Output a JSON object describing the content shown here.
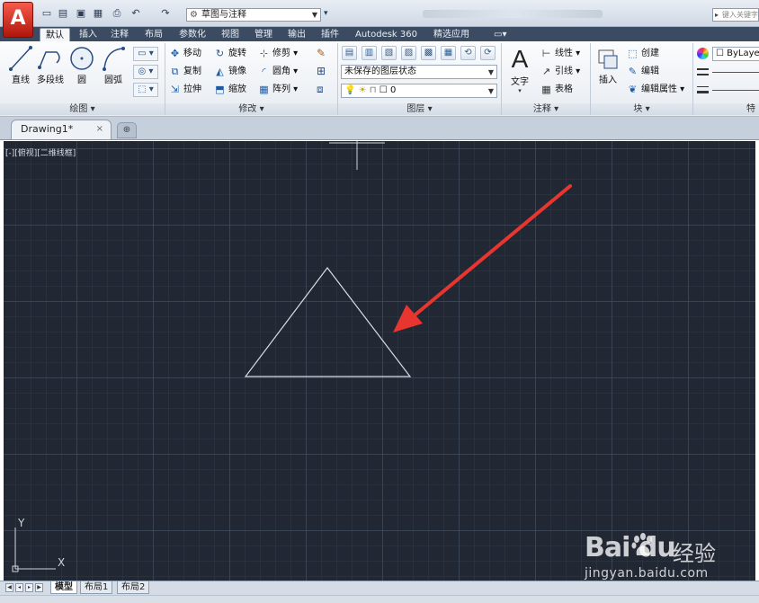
{
  "app": {
    "logo_letter": "A"
  },
  "quick_access": {
    "icons": [
      "new-icon",
      "open-icon",
      "save-icon",
      "save-as-icon",
      "print-icon",
      "undo-icon",
      "redo-icon"
    ],
    "workspace": "草图与注释"
  },
  "search": {
    "placeholder": "键入关键字"
  },
  "tabs": [
    "默认",
    "插入",
    "注释",
    "布局",
    "参数化",
    "视图",
    "管理",
    "输出",
    "插件",
    "Autodesk 360",
    "精选应用"
  ],
  "ribbon": {
    "draw": {
      "title": "绘图",
      "line": "直线",
      "polyline": "多段线",
      "circle": "圆",
      "arc": "圆弧"
    },
    "modify": {
      "title": "修改",
      "move": "移动",
      "rotate": "旋转",
      "trim": "修剪",
      "copy": "复制",
      "mirror": "镜像",
      "fillet": "圆角",
      "stretch": "拉伸",
      "scale": "缩放",
      "array": "阵列"
    },
    "layers": {
      "title": "图层",
      "layer_state": "未保存的图层状态",
      "current_layer": "0"
    },
    "annotation": {
      "title": "注释",
      "text": "文字",
      "linear": "线性",
      "leader": "引线",
      "table": "表格"
    },
    "block": {
      "title": "块",
      "insert": "插入",
      "create": "创建",
      "edit": "编辑",
      "edit_attributes": "编辑属性"
    },
    "properties": {
      "bylayer": "ByLayer",
      "truncated_title": "特"
    }
  },
  "document": {
    "tab_title": "Drawing1*",
    "close": "×"
  },
  "canvas": {
    "viewport_label": "[-][俯视][二维线框]",
    "ucs_x": "X",
    "ucs_y": "Y",
    "background": "#212833",
    "line_color": "#d9dde4",
    "arrow_color": "#e8352f"
  },
  "layout_tabs": [
    "模型",
    "布局1",
    "布局2"
  ],
  "watermark": {
    "logo": "Bai du",
    "brand": "经验",
    "url": "jingyan.baidu.com"
  }
}
